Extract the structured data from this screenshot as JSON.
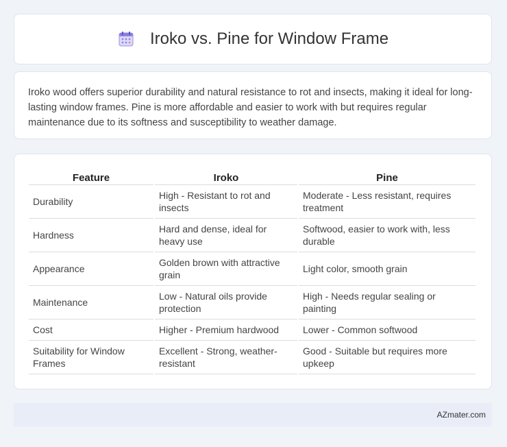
{
  "header": {
    "icon": "calendar-icon",
    "title": "Iroko vs. Pine for Window Frame"
  },
  "summary": {
    "text": "Iroko wood offers superior durability and natural resistance to rot and insects, making it ideal for long-lasting window frames. Pine is more affordable and easier to work with but requires regular maintenance due to its softness and susceptibility to weather damage."
  },
  "table": {
    "headers": [
      "Feature",
      "Iroko",
      "Pine"
    ],
    "rows": [
      [
        "Durability",
        "High - Resistant to rot and insects",
        "Moderate - Less resistant, requires treatment"
      ],
      [
        "Hardness",
        "Hard and dense, ideal for heavy use",
        "Softwood, easier to work with, less durable"
      ],
      [
        "Appearance",
        "Golden brown with attractive grain",
        "Light color, smooth grain"
      ],
      [
        "Maintenance",
        "Low - Natural oils provide protection",
        "High - Needs regular sealing or painting"
      ],
      [
        "Cost",
        "Higher - Premium hardwood",
        "Lower - Common softwood"
      ],
      [
        "Suitability for Window Frames",
        "Excellent - Strong, weather-resistant",
        "Good - Suitable but requires more upkeep"
      ]
    ]
  },
  "footer": {
    "text": "AZmater.com"
  },
  "colors": {
    "background": "#f0f3f8",
    "card": "#ffffff",
    "footer": "#e8edf7",
    "icon_accent": "#8b7fe0"
  }
}
